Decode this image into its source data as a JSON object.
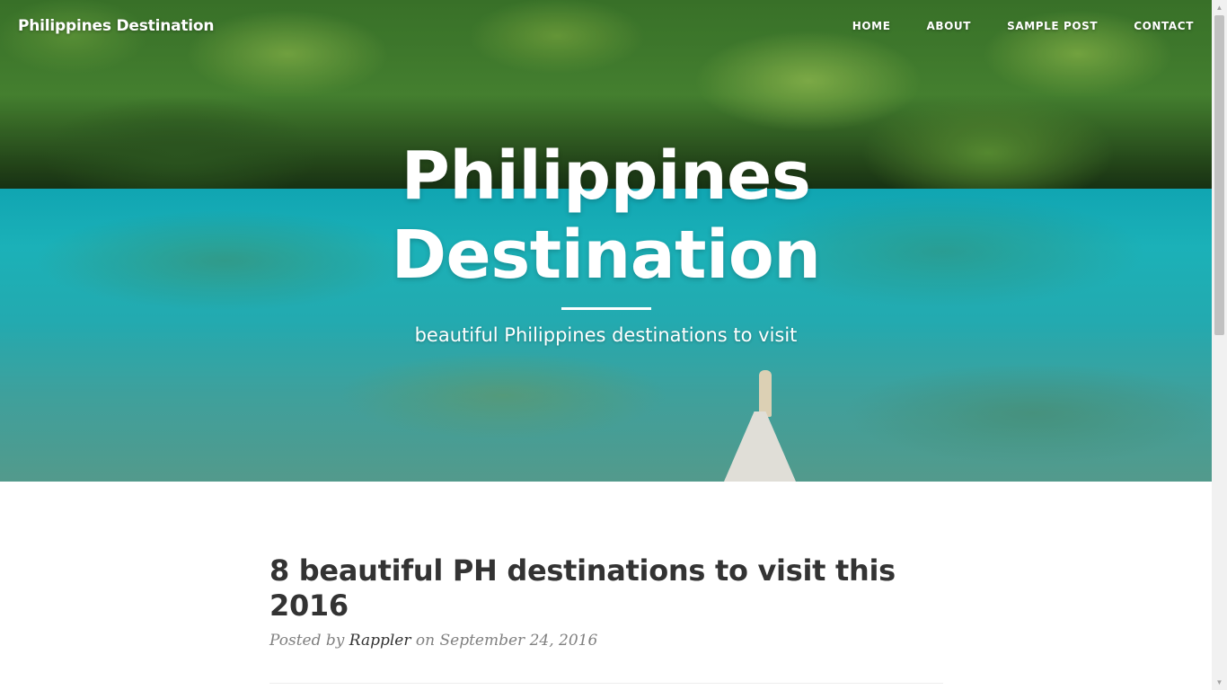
{
  "navbar": {
    "brand": "Philippines Destination",
    "links": [
      {
        "label": "HOME"
      },
      {
        "label": "ABOUT"
      },
      {
        "label": "SAMPLE POST"
      },
      {
        "label": "CONTACT"
      }
    ]
  },
  "hero": {
    "title": "Philippines Destination",
    "subheading": "beautiful Philippines destinations to visit"
  },
  "post": {
    "title": "8 beautiful PH destinations to visit this 2016",
    "meta_prefix": "Posted by",
    "author": "Rappler",
    "meta_on": "on",
    "date": "September 24, 2016"
  },
  "scrollbar": {
    "up_icon": "triangle-up",
    "down_icon": "triangle-down",
    "up_glyph": "▲",
    "down_glyph": "▼"
  },
  "colors": {
    "text_dark": "#333333",
    "text_meta": "#808080",
    "hero_text": "#ffffff",
    "water": "#1ec0c8"
  }
}
